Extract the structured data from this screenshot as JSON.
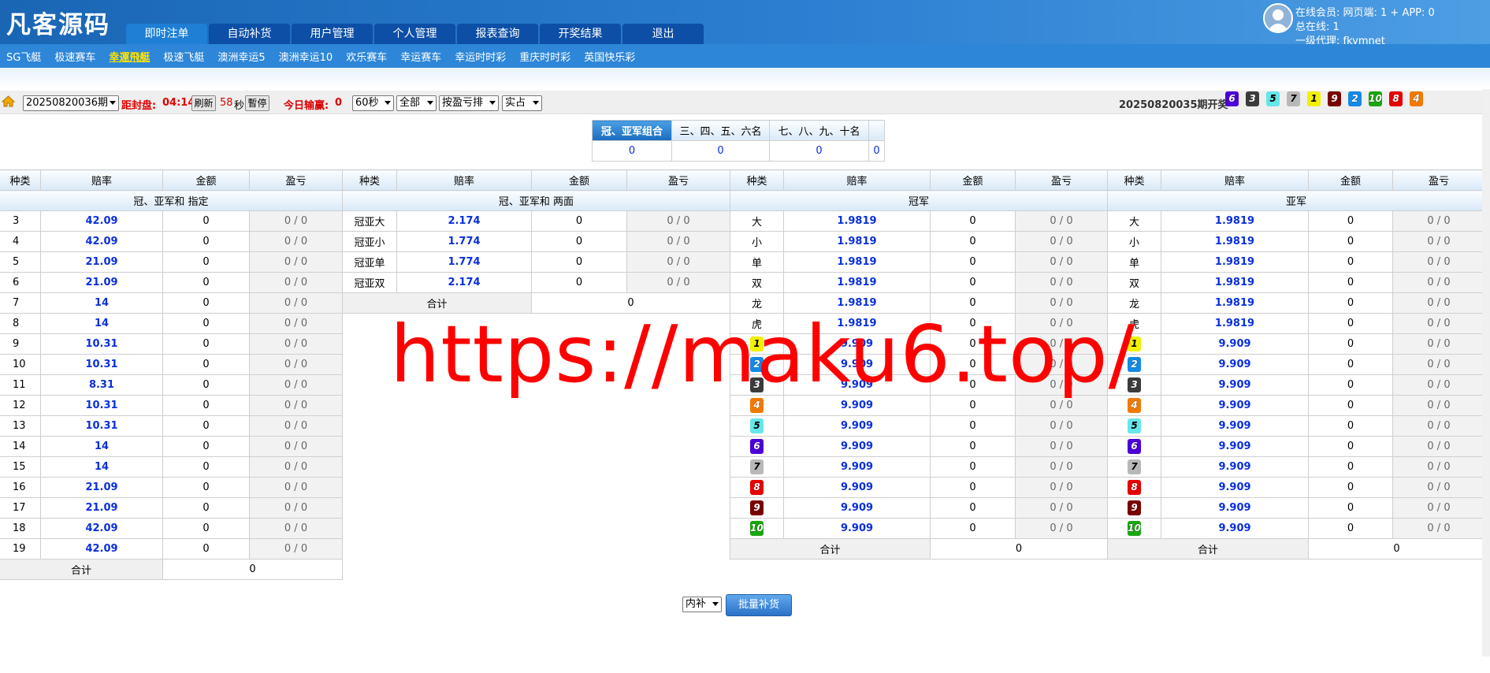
{
  "header": {
    "logo": "凡客源码",
    "tabs": [
      "即时注单",
      "自动补货",
      "用户管理",
      "个人管理",
      "报表查询",
      "开奖结果",
      "退出"
    ],
    "active_tab": "即时注单",
    "online_line": "在线会员:   网页端: 1 + APP: 0",
    "total_line": "总在线: 1",
    "agent_line": "一级代理: fkymnet"
  },
  "subnav": {
    "items": [
      "SG飞艇",
      "极速赛车",
      "幸運飛艇",
      "极速飞艇",
      "澳洲幸运5",
      "澳洲幸运10",
      "欢乐赛车",
      "幸运赛车",
      "幸运时时彩",
      "重庆时时彩",
      "英国快乐彩"
    ],
    "active": "幸運飛艇"
  },
  "toolbar": {
    "period_select": "20250820036期",
    "close_label": "距封盘:",
    "close_time": "04:14",
    "refresh_button": "刷新",
    "countdown": "58",
    "countdown_unit": "秒",
    "pause_button": "暫停",
    "today_label": "今日输赢:",
    "today_value": "0",
    "interval_select": "60秒",
    "scope_select": "全部",
    "sort_select": "按盈亏排",
    "mode_select": "实占",
    "last_period_label": "20250820035期开奖",
    "draw_numbers": [
      {
        "n": "6",
        "color": "#4a00d6"
      },
      {
        "n": "3",
        "color": "#3b3b3b"
      },
      {
        "n": "5",
        "color": "#66e6ea"
      },
      {
        "n": "7",
        "color": "#b8b8b8"
      },
      {
        "n": "1",
        "color": "#f0f000"
      },
      {
        "n": "9",
        "color": "#7a0000"
      },
      {
        "n": "2",
        "color": "#1489e6"
      },
      {
        "n": "10",
        "color": "#1ba510"
      },
      {
        "n": "8",
        "color": "#e60000"
      },
      {
        "n": "4",
        "color": "#f07a00"
      }
    ]
  },
  "combo": {
    "headers": [
      "冠、亚军组合",
      "三、四、五、六名",
      "七、八、九、十名",
      ""
    ],
    "values": [
      "0",
      "0",
      "0",
      "0"
    ]
  },
  "col_headers": [
    "种类",
    "赔率",
    "金额",
    "盈亏"
  ],
  "table1": {
    "section": "冠、亚军和 指定",
    "rows": [
      {
        "k": "3",
        "o": "42.09",
        "a": "0",
        "p": "0 / 0"
      },
      {
        "k": "4",
        "o": "42.09",
        "a": "0",
        "p": "0 / 0"
      },
      {
        "k": "5",
        "o": "21.09",
        "a": "0",
        "p": "0 / 0"
      },
      {
        "k": "6",
        "o": "21.09",
        "a": "0",
        "p": "0 / 0"
      },
      {
        "k": "7",
        "o": "14",
        "a": "0",
        "p": "0 / 0"
      },
      {
        "k": "8",
        "o": "14",
        "a": "0",
        "p": "0 / 0"
      },
      {
        "k": "9",
        "o": "10.31",
        "a": "0",
        "p": "0 / 0"
      },
      {
        "k": "10",
        "o": "10.31",
        "a": "0",
        "p": "0 / 0"
      },
      {
        "k": "11",
        "o": "8.31",
        "a": "0",
        "p": "0 / 0"
      },
      {
        "k": "12",
        "o": "10.31",
        "a": "0",
        "p": "0 / 0"
      },
      {
        "k": "13",
        "o": "10.31",
        "a": "0",
        "p": "0 / 0"
      },
      {
        "k": "14",
        "o": "14",
        "a": "0",
        "p": "0 / 0"
      },
      {
        "k": "15",
        "o": "14",
        "a": "0",
        "p": "0 / 0"
      },
      {
        "k": "16",
        "o": "21.09",
        "a": "0",
        "p": "0 / 0"
      },
      {
        "k": "17",
        "o": "21.09",
        "a": "0",
        "p": "0 / 0"
      },
      {
        "k": "18",
        "o": "42.09",
        "a": "0",
        "p": "0 / 0"
      },
      {
        "k": "19",
        "o": "42.09",
        "a": "0",
        "p": "0 / 0"
      }
    ],
    "total_label": "合计",
    "total_value": "0"
  },
  "table2": {
    "section": "冠、亚军和 两面",
    "rows": [
      {
        "k": "冠亚大",
        "o": "2.174",
        "a": "0",
        "p": "0 / 0"
      },
      {
        "k": "冠亚小",
        "o": "1.774",
        "a": "0",
        "p": "0 / 0"
      },
      {
        "k": "冠亚单",
        "o": "1.774",
        "a": "0",
        "p": "0 / 0"
      },
      {
        "k": "冠亚双",
        "o": "2.174",
        "a": "0",
        "p": "0 / 0"
      }
    ],
    "total_label": "合计",
    "total_value": "0"
  },
  "table3": {
    "section": "冠军",
    "rows": [
      {
        "k": "大",
        "o": "1.9819",
        "a": "0",
        "p": "0 / 0"
      },
      {
        "k": "小",
        "o": "1.9819",
        "a": "0",
        "p": "0 / 0"
      },
      {
        "k": "单",
        "o": "1.9819",
        "a": "0",
        "p": "0 / 0"
      },
      {
        "k": "双",
        "o": "1.9819",
        "a": "0",
        "p": "0 / 0"
      },
      {
        "k": "龙",
        "o": "1.9819",
        "a": "0",
        "p": "0 / 0"
      },
      {
        "k": "虎",
        "o": "1.9819",
        "a": "0",
        "p": "0 / 0"
      },
      {
        "k": "1",
        "ball": "#f0f000",
        "o": "9.909",
        "a": "0",
        "p": "0 / 0"
      },
      {
        "k": "2",
        "ball": "#1489e6",
        "o": "9.909",
        "a": "0",
        "p": "0 / 0"
      },
      {
        "k": "3",
        "ball": "#3b3b3b",
        "o": "9.909",
        "a": "0",
        "p": "0 / 0"
      },
      {
        "k": "4",
        "ball": "#f07a00",
        "o": "9.909",
        "a": "0",
        "p": "0 / 0"
      },
      {
        "k": "5",
        "ball": "#66e6ea",
        "o": "9.909",
        "a": "0",
        "p": "0 / 0"
      },
      {
        "k": "6",
        "ball": "#4a00d6",
        "o": "9.909",
        "a": "0",
        "p": "0 / 0"
      },
      {
        "k": "7",
        "ball": "#b8b8b8",
        "o": "9.909",
        "a": "0",
        "p": "0 / 0"
      },
      {
        "k": "8",
        "ball": "#e60000",
        "o": "9.909",
        "a": "0",
        "p": "0 / 0"
      },
      {
        "k": "9",
        "ball": "#7a0000",
        "o": "9.909",
        "a": "0",
        "p": "0 / 0"
      },
      {
        "k": "10",
        "ball": "#1ba510",
        "o": "9.909",
        "a": "0",
        "p": "0 / 0"
      }
    ],
    "total_label": "合计",
    "total_value": "0"
  },
  "table4": {
    "section": "亚军",
    "rows": [
      {
        "k": "大",
        "o": "1.9819",
        "a": "0",
        "p": "0 / 0"
      },
      {
        "k": "小",
        "o": "1.9819",
        "a": "0",
        "p": "0 / 0"
      },
      {
        "k": "单",
        "o": "1.9819",
        "a": "0",
        "p": "0 / 0"
      },
      {
        "k": "双",
        "o": "1.9819",
        "a": "0",
        "p": "0 / 0"
      },
      {
        "k": "龙",
        "o": "1.9819",
        "a": "0",
        "p": "0 / 0"
      },
      {
        "k": "虎",
        "o": "1.9819",
        "a": "0",
        "p": "0 / 0"
      },
      {
        "k": "1",
        "ball": "#f0f000",
        "o": "9.909",
        "a": "0",
        "p": "0 / 0"
      },
      {
        "k": "2",
        "ball": "#1489e6",
        "o": "9.909",
        "a": "0",
        "p": "0 / 0"
      },
      {
        "k": "3",
        "ball": "#3b3b3b",
        "o": "9.909",
        "a": "0",
        "p": "0 / 0"
      },
      {
        "k": "4",
        "ball": "#f07a00",
        "o": "9.909",
        "a": "0",
        "p": "0 / 0"
      },
      {
        "k": "5",
        "ball": "#66e6ea",
        "o": "9.909",
        "a": "0",
        "p": "0 / 0"
      },
      {
        "k": "6",
        "ball": "#4a00d6",
        "o": "9.909",
        "a": "0",
        "p": "0 / 0"
      },
      {
        "k": "7",
        "ball": "#b8b8b8",
        "o": "9.909",
        "a": "0",
        "p": "0 / 0"
      },
      {
        "k": "8",
        "ball": "#e60000",
        "o": "9.909",
        "a": "0",
        "p": "0 / 0"
      },
      {
        "k": "9",
        "ball": "#7a0000",
        "o": "9.909",
        "a": "0",
        "p": "0 / 0"
      },
      {
        "k": "10",
        "ball": "#1ba510",
        "o": "9.909",
        "a": "0",
        "p": "0 / 0"
      }
    ],
    "total_label": "合计",
    "total_value": "0"
  },
  "footer": {
    "mode_select": "内补",
    "batch_button": "批量补货"
  },
  "watermark": "https://maku6.top/"
}
